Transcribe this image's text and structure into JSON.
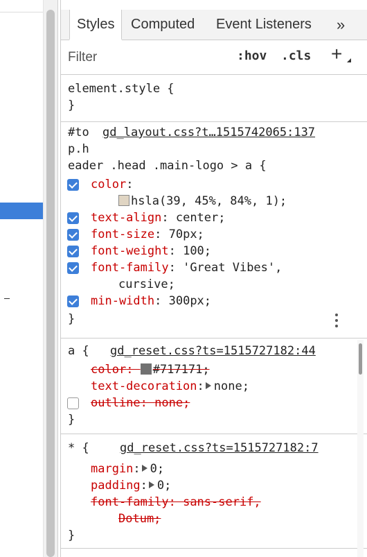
{
  "tabs": {
    "styles": "Styles",
    "computed": "Computed",
    "event_listeners": "Event Listeners",
    "more": "»"
  },
  "filter": {
    "placeholder": "Filter",
    "hov": ":hov",
    "cls": ".cls",
    "add": "+"
  },
  "element_style": {
    "selector": "element.style {",
    "close": "}"
  },
  "rule1": {
    "selector_prefix": "#to",
    "source": "gd_layout.css?t…1515742065:137",
    "selector_line2": "p.h",
    "selector_line3": "eader .head .main-logo > a {",
    "declarations": [
      {
        "name": "color",
        "value": "hsla(39, 45%, 84%, 1);",
        "swatch": "#e0d5c3"
      },
      {
        "name": "text-align",
        "value": "center;"
      },
      {
        "name": "font-size",
        "value": "70px;"
      },
      {
        "name": "font-weight",
        "value": "100;"
      },
      {
        "name": "font-family",
        "value": "'Great Vibes',",
        "value_cont": "cursive;"
      },
      {
        "name": "min-width",
        "value": "300px;"
      }
    ],
    "close": "}"
  },
  "rule2": {
    "selector": "a {",
    "source": "gd_reset.css?ts=1515727182:44",
    "declarations": [
      {
        "name": "color",
        "value": "#717171;",
        "swatch": "#717171",
        "overridden": true
      },
      {
        "name": "text-decoration",
        "value": "none;"
      },
      {
        "name": "outline",
        "value": "none;",
        "overridden": true,
        "disabled": true
      }
    ],
    "close": "}"
  },
  "rule3": {
    "selector": "* {",
    "source": "gd_reset.css?ts=1515727182:7",
    "declarations": [
      {
        "name": "margin",
        "value": "0;"
      },
      {
        "name": "padding",
        "value": "0;"
      },
      {
        "name": "font-family",
        "value": "sans-serif,",
        "value_cont": "Dotum;",
        "overridden": true
      }
    ],
    "close": "}"
  },
  "colors": {
    "accent": "#3d7fd9",
    "property": "#c80000"
  }
}
